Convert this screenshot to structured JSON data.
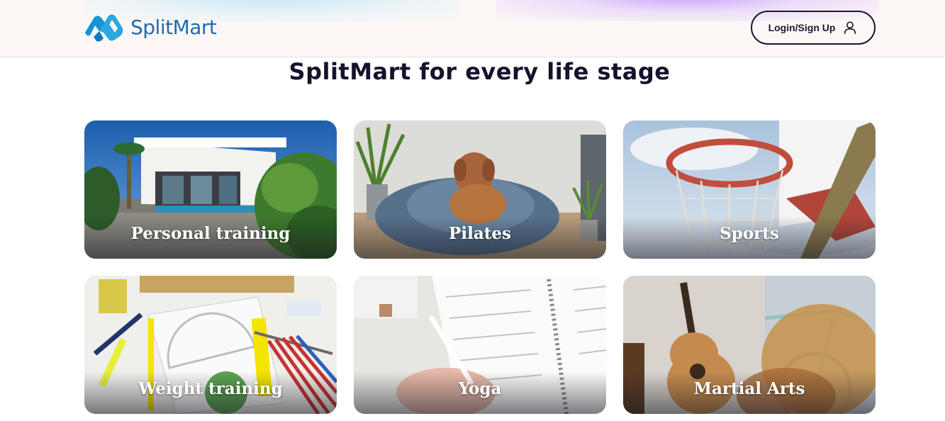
{
  "brand": {
    "name": "SplitMart"
  },
  "header": {
    "login_label": "Login/Sign Up"
  },
  "section": {
    "title": "SplitMart for every life stage"
  },
  "cards": [
    {
      "label": "Personal training",
      "image": "modern-house-with-pool-and-palms"
    },
    {
      "label": "Pilates",
      "image": "dog-on-blue-bean-bag"
    },
    {
      "label": "Sports",
      "image": "basketball-hoop-with-net"
    },
    {
      "label": "Weight training",
      "image": "ruler-protractor-pencils-on-notebook"
    },
    {
      "label": "Yoga",
      "image": "hand-writing-in-planner"
    },
    {
      "label": "Martial Arts",
      "image": "acoustic-guitar-and-bicycle"
    }
  ],
  "colors": {
    "brand_blue": "#1f6bb0",
    "logo_cyan": "#2aa7df",
    "text_dark": "#15132b",
    "header_bg": "#fdf8f6"
  }
}
